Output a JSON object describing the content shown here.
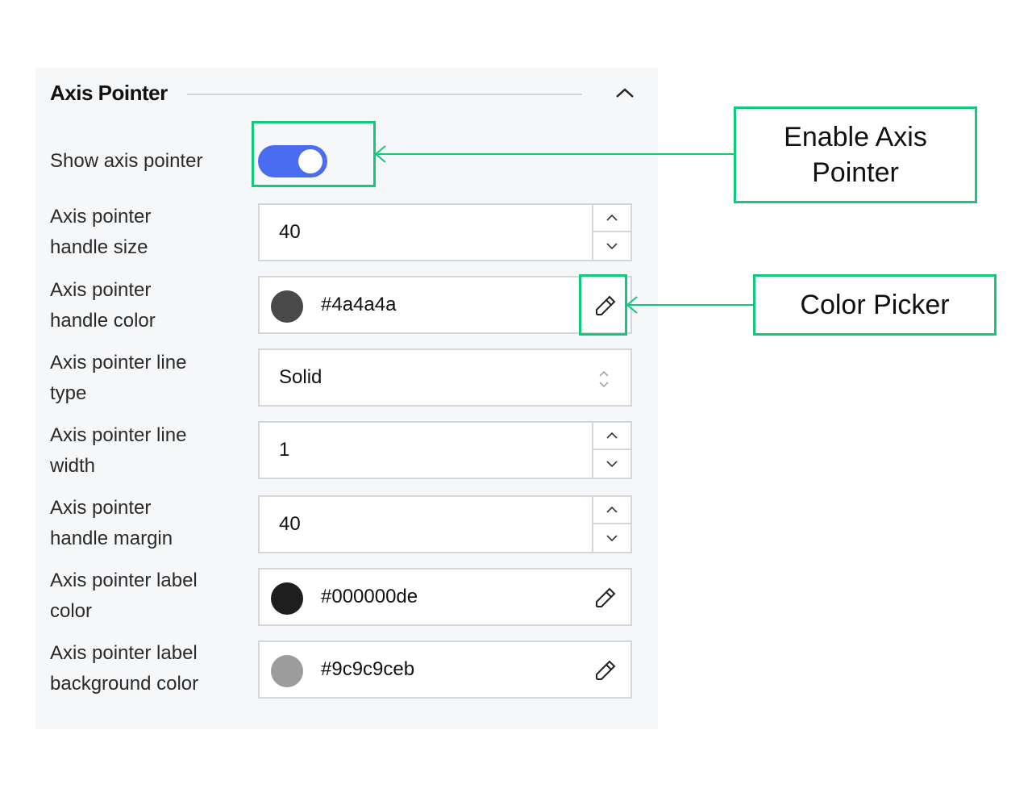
{
  "section": {
    "title": "Axis Pointer",
    "collapse_icon": "chevron-up-icon"
  },
  "fields": {
    "show_axis_pointer": {
      "label": "Show axis pointer",
      "enabled": true
    },
    "handle_size": {
      "label_line1": "Axis pointer",
      "label_line2": "handle size",
      "value": "40"
    },
    "handle_color": {
      "label_line1": "Axis pointer",
      "label_line2": "handle color",
      "value": "#4a4a4a",
      "swatch": "#4a4a4a"
    },
    "line_type": {
      "label_line1": "Axis pointer line",
      "label_line2": "type",
      "value": "Solid"
    },
    "line_width": {
      "label_line1": "Axis pointer line",
      "label_line2": "width",
      "value": "1"
    },
    "handle_margin": {
      "label_line1": "Axis pointer",
      "label_line2": "handle margin",
      "value": "40"
    },
    "label_color": {
      "label_line1": "Axis pointer label",
      "label_line2": "color",
      "value": "#000000de",
      "swatch": "#1e1e1e"
    },
    "label_bg_color": {
      "label_line1": "Axis pointer label",
      "label_line2": "background color",
      "value": "#9c9c9ceb",
      "swatch": "#9c9c9c"
    }
  },
  "annotations": {
    "enable_axis_pointer": {
      "line1": "Enable Axis",
      "line2": "Pointer"
    },
    "color_picker": "Color Picker",
    "accent": "#12c97b"
  }
}
